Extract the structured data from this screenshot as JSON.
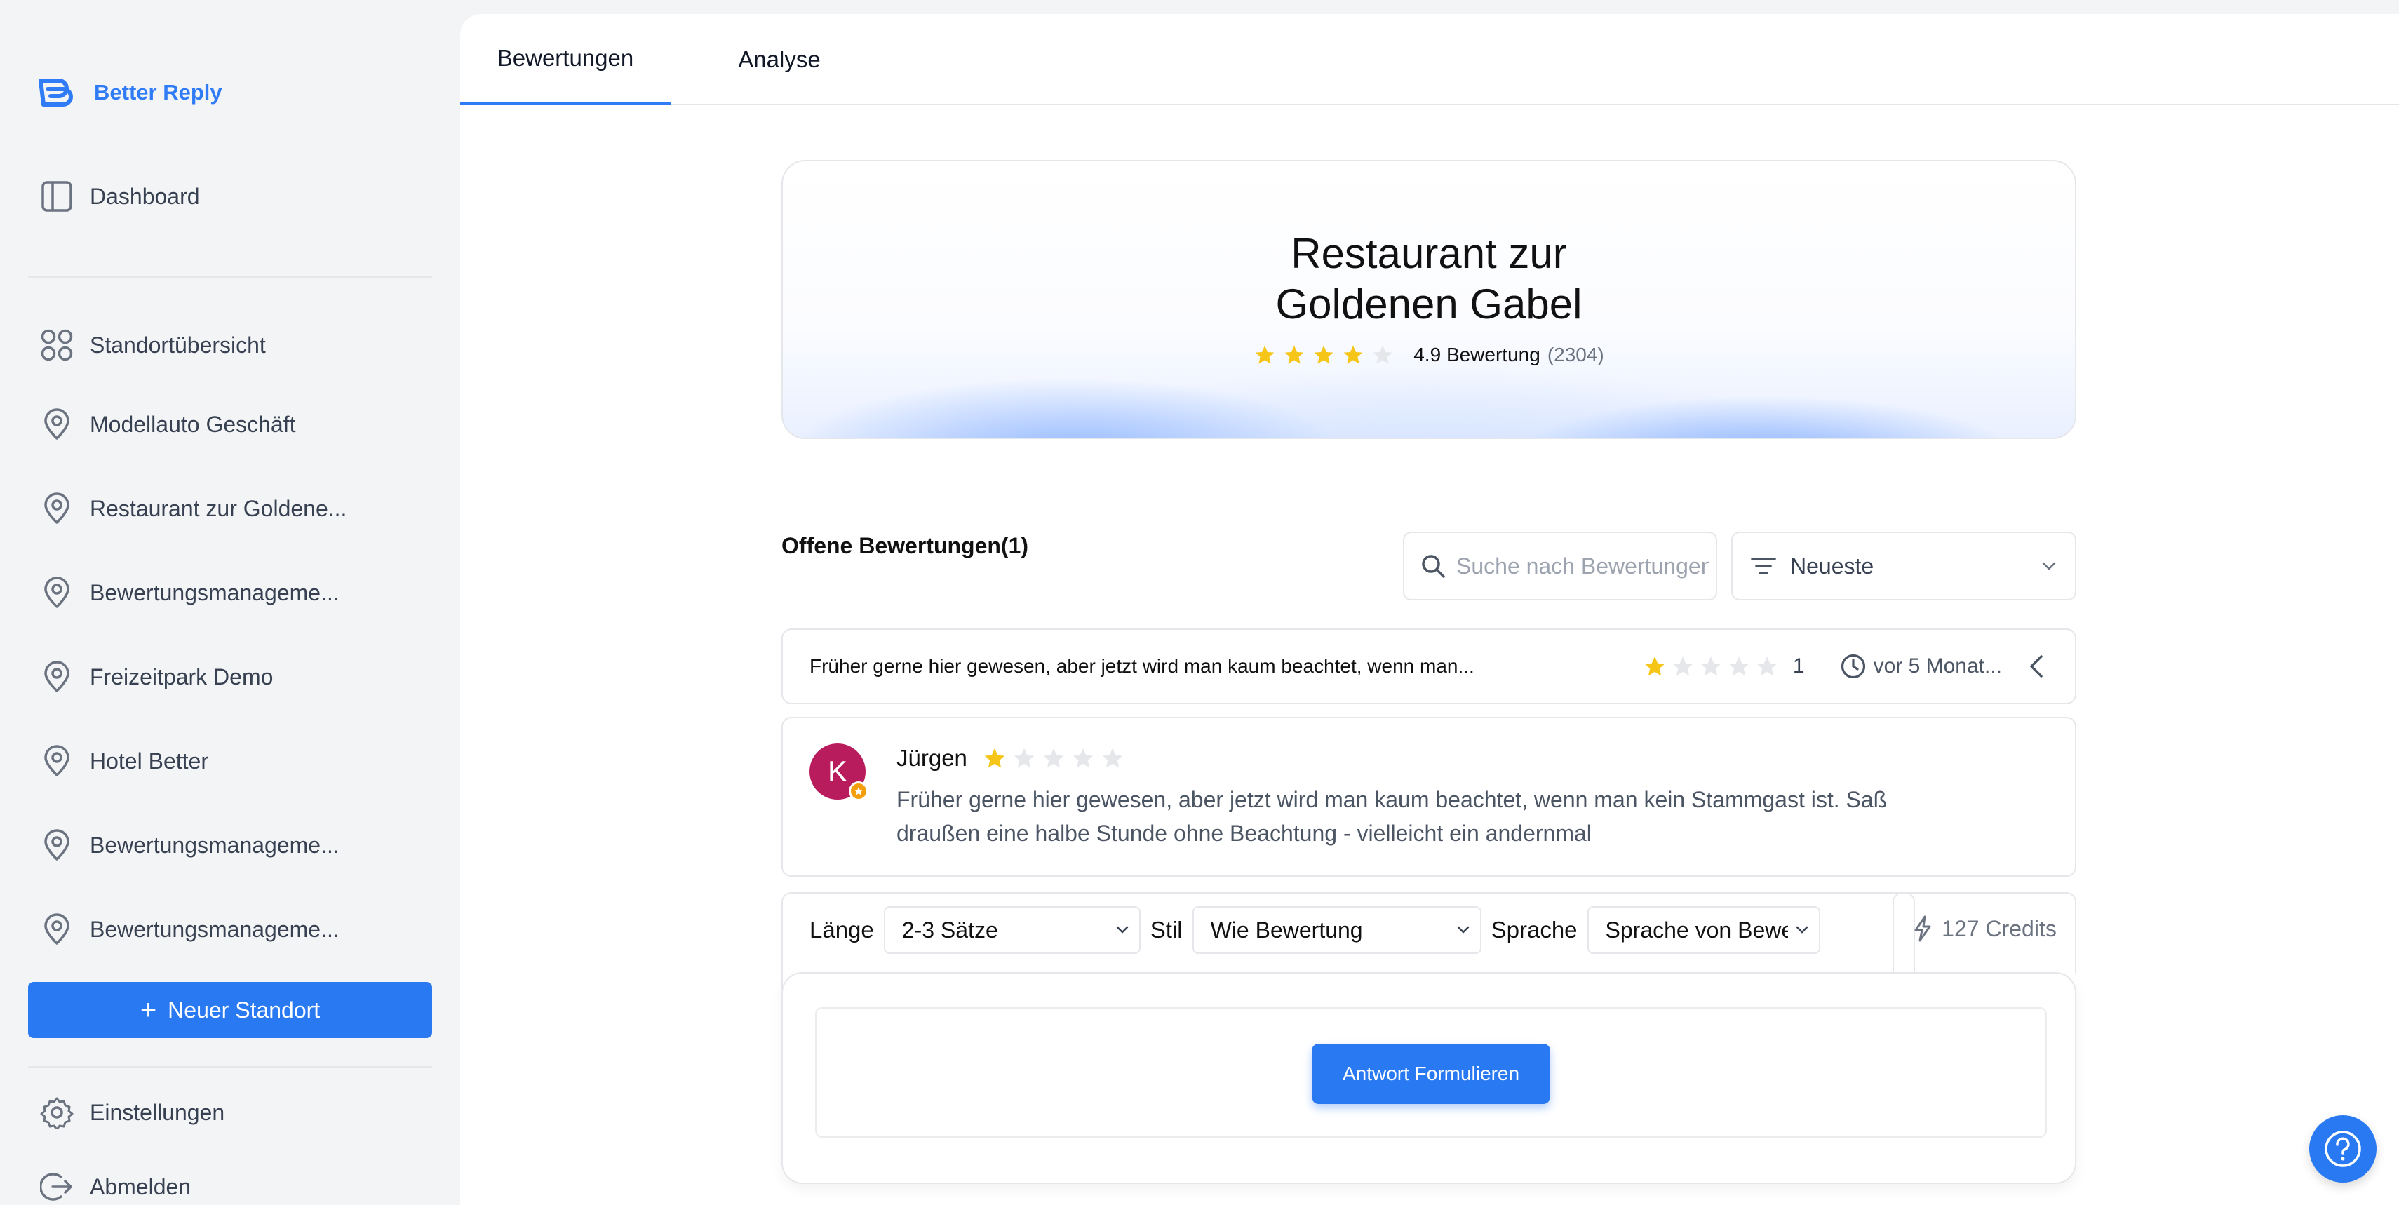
{
  "brand": {
    "name": "Better Reply",
    "color": "#2f7cf6"
  },
  "sidebar": {
    "dashboard": {
      "label": "Dashboard",
      "icon": "sidebar-panel-icon"
    },
    "items": [
      {
        "label": "Standortübersicht",
        "icon": "grid-circles-icon"
      },
      {
        "label": "Modellauto Geschäft",
        "icon": "location-pin-icon"
      },
      {
        "label": "Restaurant zur Goldene...",
        "icon": "location-pin-icon"
      },
      {
        "label": "Bewertungsmanageme...",
        "icon": "location-pin-icon"
      },
      {
        "label": "Freizeitpark Demo",
        "icon": "location-pin-icon"
      },
      {
        "label": "Hotel Better",
        "icon": "location-pin-icon"
      },
      {
        "label": "Bewertungsmanageme...",
        "icon": "location-pin-icon"
      },
      {
        "label": "Bewertungsmanageme...",
        "icon": "location-pin-icon"
      }
    ],
    "new_location_label": "Neuer Standort",
    "settings_label": "Einstellungen",
    "logout_label": "Abmelden"
  },
  "tabs": [
    {
      "label": "Bewertungen",
      "active": true
    },
    {
      "label": "Analyse",
      "active": false
    }
  ],
  "hero": {
    "title_line1": "Restaurant zur",
    "title_line2": "Goldenen Gabel",
    "stars_filled": 4,
    "stars_total": 5,
    "rating_text": "4.9 Bewertung",
    "rating_count": "(2304)"
  },
  "reviews": {
    "open_label": "Offene Bewertungen(1)",
    "search_placeholder": "Suche nach Bewertungen",
    "sort_label": "Neueste",
    "row": {
      "snippet": "Früher gerne hier gewesen, aber jetzt wird man kaum beachtet, wenn man...",
      "stars_filled": 1,
      "rating_value": "1",
      "time": "vor 5 Monat..."
    },
    "detail": {
      "avatar_initial": "K",
      "reviewer_name": "Jürgen",
      "stars_filled": 1,
      "text": "Früher gerne hier gewesen, aber jetzt wird man kaum beachtet, wenn man kein Stammgast ist. Saß draußen eine halbe Stunde ohne Beachtung - vielleicht ein andernmal"
    }
  },
  "controls": {
    "length_label": "Länge",
    "length_value": "2-3 Sätze",
    "style_label": "Stil",
    "style_value": "Wie Bewertung",
    "language_label": "Sprache",
    "language_value": "Sprache von Bewertung",
    "credits": "127 Credits"
  },
  "compose": {
    "button_label": "Antwort Formulieren"
  },
  "colors": {
    "accent": "#2979f2",
    "star": "#f5c518",
    "star_empty": "#e5e7eb",
    "avatar": "#b91c5c"
  }
}
